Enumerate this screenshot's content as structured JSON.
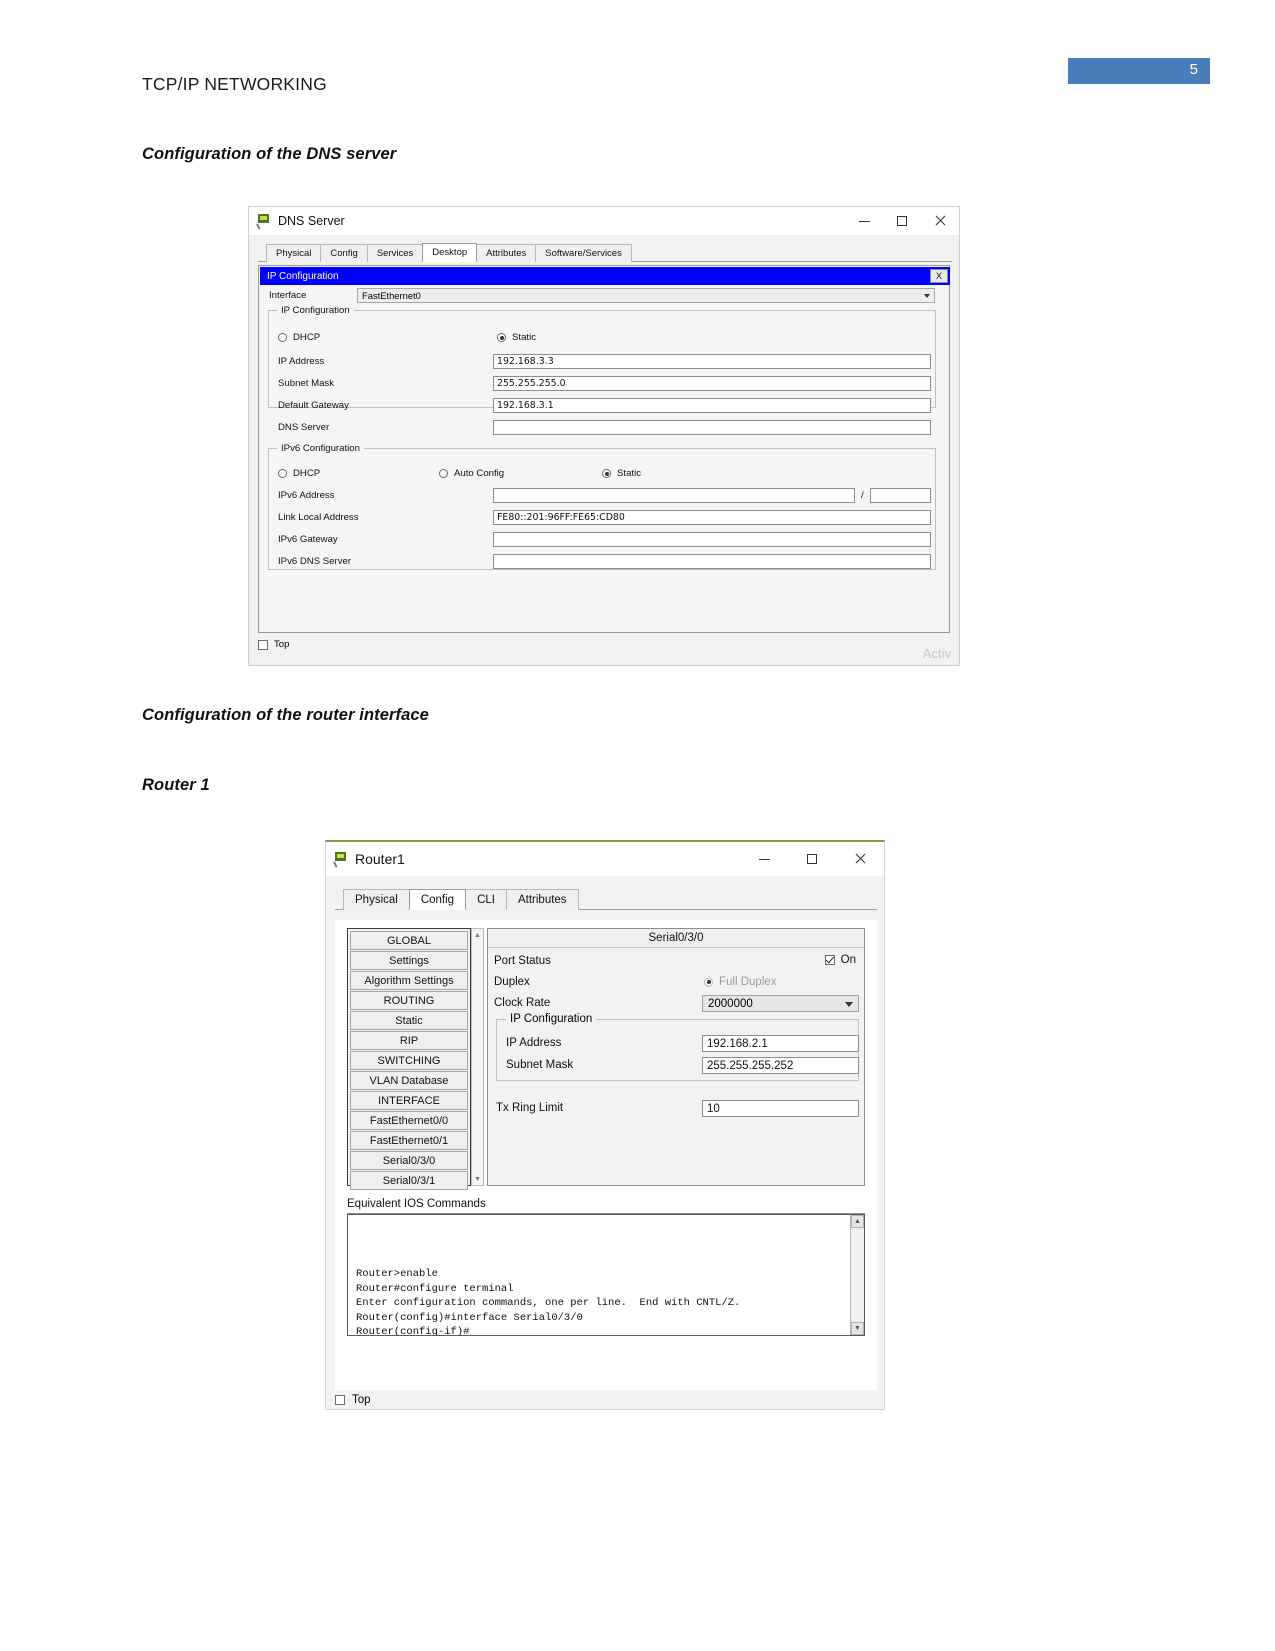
{
  "document": {
    "header_title": "TCP/IP NETWORKING",
    "page_number": "5",
    "page_badge_color": "#4a7ebb",
    "headings": {
      "dns": "Configuration of the DNS server",
      "router_interface": "Configuration of the router interface",
      "router1": "Router 1"
    }
  },
  "dns_window": {
    "title": "DNS Server",
    "icon": "device-icon",
    "controls": {
      "minimize": "minimize-icon",
      "maximize": "maximize-icon",
      "close": "close-icon"
    },
    "tabs": [
      {
        "label": "Physical",
        "active": false
      },
      {
        "label": "Config",
        "active": false
      },
      {
        "label": "Services",
        "active": false
      },
      {
        "label": "Desktop",
        "active": true
      },
      {
        "label": "Attributes",
        "active": false
      },
      {
        "label": "Software/Services",
        "active": false
      }
    ],
    "panel": {
      "title": "IP Configuration",
      "title_bar_color": "#0000ff",
      "close_label": "X",
      "interface_label": "Interface",
      "interface_value": "FastEthernet0"
    },
    "ipv4": {
      "legend": "IP Configuration",
      "dhcp_label": "DHCP",
      "dhcp_selected": false,
      "static_label": "Static",
      "static_selected": true,
      "fields": [
        {
          "label": "IP Address",
          "value": "192.168.3.3"
        },
        {
          "label": "Subnet Mask",
          "value": "255.255.255.0"
        },
        {
          "label": "Default Gateway",
          "value": "192.168.3.1"
        },
        {
          "label": "DNS Server",
          "value": ""
        }
      ]
    },
    "ipv6": {
      "legend": "IPv6 Configuration",
      "dhcp_label": "DHCP",
      "dhcp_selected": false,
      "autoconfig_label": "Auto Config",
      "autoconfig_selected": false,
      "static_label": "Static",
      "static_selected": true,
      "address_label": "IPv6 Address",
      "address_value": "",
      "prefix_separator": "/",
      "prefix_value": "",
      "link_local_label": "Link Local Address",
      "link_local_value": "FE80::201:96FF:FE65:CD80",
      "gateway_label": "IPv6 Gateway",
      "gateway_value": "",
      "dns_label": "IPv6 DNS Server",
      "dns_value": ""
    },
    "footer": {
      "top_checkbox_label": "Top",
      "top_checked": false,
      "watermark": "Activ"
    }
  },
  "router_window": {
    "title": "Router1",
    "icon": "device-icon",
    "controls": {
      "minimize": "minimize-icon",
      "maximize": "maximize-icon",
      "close": "close-icon"
    },
    "tabs": [
      {
        "label": "Physical",
        "active": false
      },
      {
        "label": "Config",
        "active": true
      },
      {
        "label": "CLI",
        "active": false
      },
      {
        "label": "Attributes",
        "active": false
      }
    ],
    "sidebar": [
      {
        "label": "GLOBAL"
      },
      {
        "label": "Settings"
      },
      {
        "label": "Algorithm Settings"
      },
      {
        "label": "ROUTING"
      },
      {
        "label": "Static"
      },
      {
        "label": "RIP"
      },
      {
        "label": "SWITCHING"
      },
      {
        "label": "VLAN Database"
      },
      {
        "label": "INTERFACE"
      },
      {
        "label": "FastEthernet0/0"
      },
      {
        "label": "FastEthernet0/1"
      },
      {
        "label": "Serial0/3/0"
      },
      {
        "label": "Serial0/3/1"
      }
    ],
    "config": {
      "header": "Serial0/3/0",
      "port_status_label": "Port Status",
      "port_status_value": "On",
      "port_status_checked": true,
      "duplex_label": "Duplex",
      "duplex_value": "Full Duplex",
      "duplex_selected": true,
      "clock_rate_label": "Clock Rate",
      "clock_rate_value": "2000000",
      "ip_group_legend": "IP Configuration",
      "ip_address_label": "IP Address",
      "ip_address_value": "192.168.2.1",
      "subnet_mask_label": "Subnet Mask",
      "subnet_mask_value": "255.255.255.252",
      "tx_ring_label": "Tx Ring Limit",
      "tx_ring_value": "10"
    },
    "ios": {
      "label": "Equivalent IOS Commands",
      "text": "Router>enable\nRouter#configure terminal\nEnter configuration commands, one per line.  End with CNTL/Z.\nRouter(config)#interface Serial0/3/0\nRouter(config-if)#"
    },
    "footer": {
      "top_checkbox_label": "Top",
      "top_checked": false
    }
  }
}
